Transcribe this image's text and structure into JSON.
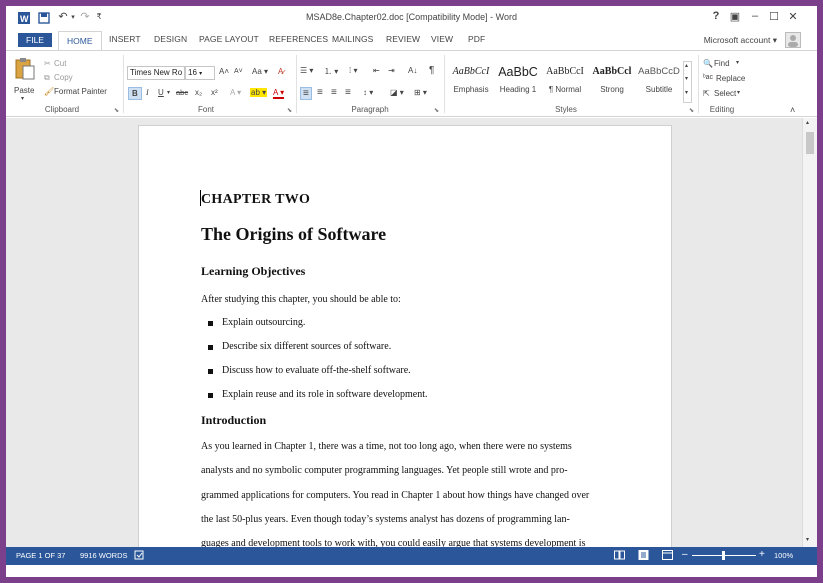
{
  "window": {
    "title": "MSAD8e.Chapter02.doc [Compatibility Mode] - Word",
    "help": "?",
    "restore_ribbon": "▣",
    "minimize": "–",
    "maximize": "☐",
    "close": "✕"
  },
  "quick_access": {
    "undo": "↶",
    "undo_arrow": "▾",
    "redo": "↷",
    "customize": "₹"
  },
  "tabs": {
    "file": "FILE",
    "home": "HOME",
    "insert": "INSERT",
    "design": "DESIGN",
    "page_layout": "PAGE LAYOUT",
    "references": "REFERENCES",
    "mailings": "MAILINGS",
    "review": "REVIEW",
    "view": "VIEW",
    "pdf": "PDF"
  },
  "account": {
    "label": "Microsoft account",
    "arrow": "▾"
  },
  "ribbon": {
    "clipboard": {
      "label": "Clipboard",
      "paste": "Paste",
      "paste_arrow": "▾",
      "cut": "Cut",
      "copy": "Copy",
      "format_painter": "Format Painter"
    },
    "font": {
      "label": "Font",
      "font_name": "Times New Ro",
      "font_size": "16",
      "grow": "A˄",
      "shrink": "A˅",
      "change_case": "Aa ▾",
      "clear_format": "A̷",
      "bold": "B",
      "italic": "I",
      "underline": "U",
      "underline_arrow": "▾",
      "strikethrough": "abc",
      "subscript": "x₂",
      "superscript": "x²",
      "text_effects": "A ▾",
      "highlight": "ab ▾",
      "font_color": "A ▾"
    },
    "paragraph": {
      "label": "Paragraph",
      "bullets": "☰ ▾",
      "numbering": "⒈ ▾",
      "multilevel": "⁞ ▾",
      "decrease_indent": "⇤",
      "increase_indent": "⇥",
      "sort": "A↓",
      "show_marks": "¶",
      "align_left": "≡",
      "center": "≡",
      "align_right": "≡",
      "justify": "≡",
      "line_spacing": "↕ ▾",
      "shading": "◪ ▾",
      "borders": "⊞ ▾"
    },
    "styles": {
      "label": "Styles",
      "items": [
        {
          "sample": "AaBbCcI",
          "name": "Emphasis"
        },
        {
          "sample": "AaBbC",
          "name": "Heading 1"
        },
        {
          "sample": "AaBbCcI",
          "name": "¶ Normal"
        },
        {
          "sample": "AaBbCcl",
          "name": "Strong"
        },
        {
          "sample": "AaBbCcD",
          "name": "Subtitle"
        }
      ]
    },
    "editing": {
      "label": "Editing",
      "find": "Find",
      "find_arrow": "▾",
      "replace": "Replace",
      "select": "Select",
      "select_arrow": "▾"
    },
    "collapse": "˄"
  },
  "document": {
    "chapter": "CHAPTER TWO",
    "title": "The Origins of Software",
    "objectives_heading": "Learning Objectives",
    "objectives_intro": "After studying this chapter, you should be able to:",
    "objectives": [
      "Explain outsourcing.",
      "Describe six different sources of software.",
      "Discuss how to evaluate off-the-shelf software.",
      "Explain reuse and its role in software development."
    ],
    "intro_heading": "Introduction",
    "intro_lines": [
      "As you learned in Chapter 1, there was a time, not too long ago, when there were no systems",
      "analysts and no symbolic computer programming languages. Yet people still wrote and pro-",
      "grammed applications for computers. You read in Chapter 1 about how things have changed over",
      "the last 50-plus years. Even though today’s systems analyst has dozens of programming lan-",
      "and development tools to work with, you could easily argue that systems development is"
    ],
    "intro_line5_underlined": "guages"
  },
  "status": {
    "page": "PAGE 1 OF 37",
    "words": "9916 WORDS",
    "zoom_minus": "–",
    "zoom_plus": "+",
    "zoom": "100%"
  },
  "colors": {
    "accent": "#2b579a",
    "frame": "#7b3f8c"
  }
}
